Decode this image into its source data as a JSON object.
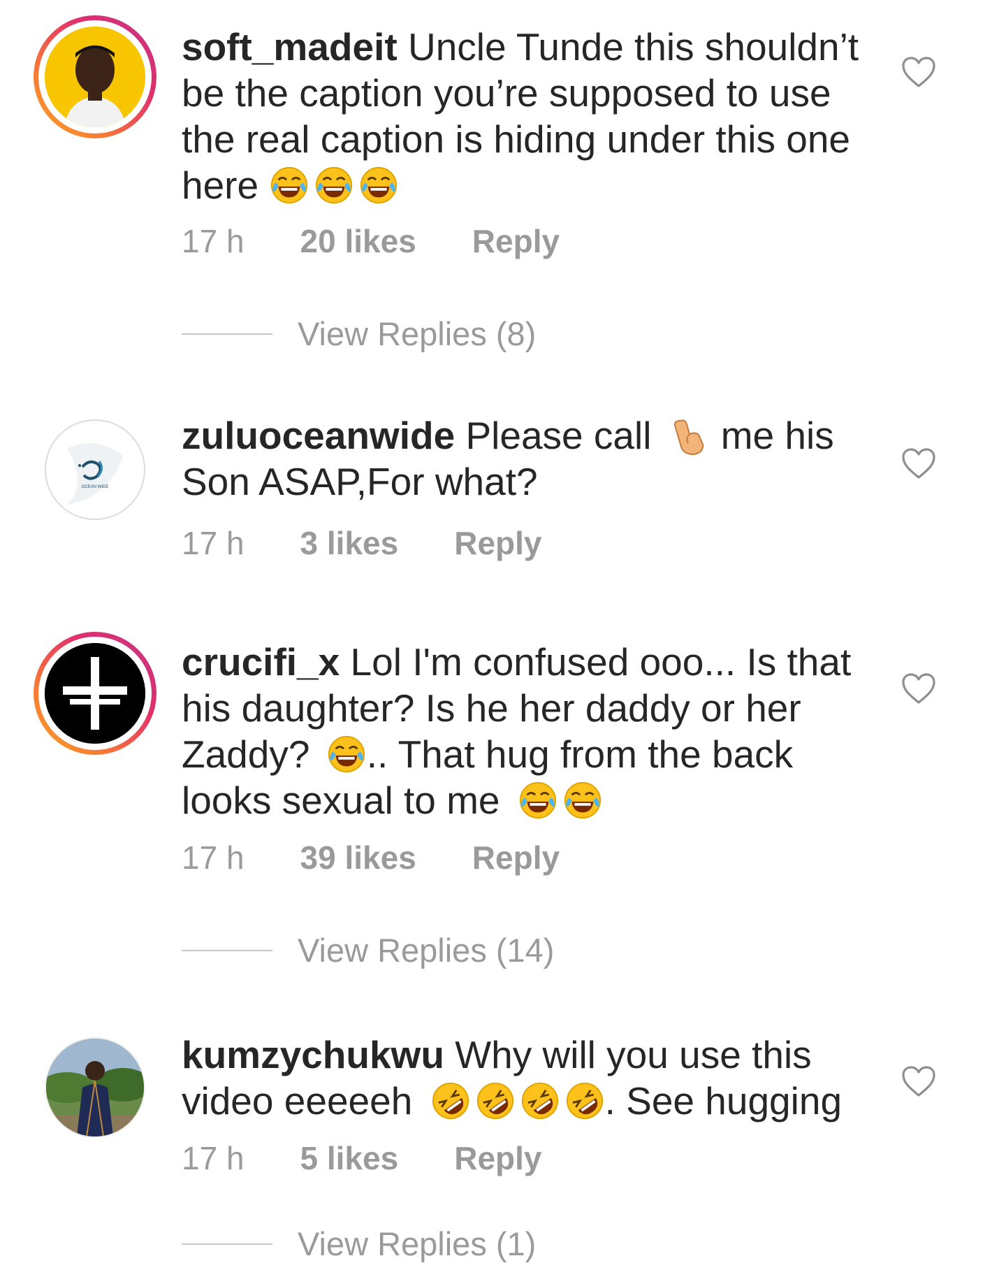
{
  "comments": [
    {
      "username": "soft_madeit",
      "text_lines": [
        "Uncle Tunde this shouldn’t",
        "be the caption you’re supposed to use",
        "the real caption is hiding under this one",
        "here"
      ],
      "time": "17 h",
      "likes": "20 likes",
      "reply": "Reply",
      "view_replies": "View Replies (8)",
      "story_ring": true
    },
    {
      "username": "zuluoceanwide",
      "text_lines": [
        "Please call",
        "me his",
        "Son ASAP,For what?"
      ],
      "avatar_text": "OCEAN WIDE",
      "time": "17 h",
      "likes": "3 likes",
      "reply": "Reply",
      "story_ring": false
    },
    {
      "username": "crucifi_x",
      "text_lines": [
        "Lol I'm confused ooo... Is that",
        "his daughter? Is he her daddy or her",
        "Zaddy?",
        ".. That hug from the back",
        "looks sexual to me"
      ],
      "time": "17 h",
      "likes": "39 likes",
      "reply": "Reply",
      "view_replies": "View Replies (14)",
      "story_ring": true
    },
    {
      "username": "kumzychukwu",
      "text_lines": [
        "Why will you use this",
        "video eeeeeh",
        ". See hugging"
      ],
      "time": "17 h",
      "likes": "5 likes",
      "reply": "Reply",
      "story_ring": false
    }
  ],
  "partial_view_replies": "View Replies (1)",
  "icons": {
    "like": "heart-outline-icon",
    "emoji_laugh": "face-with-tears-of-joy-icon",
    "emoji_rofl": "rolling-on-floor-laughing-icon",
    "emoji_callme": "call-me-hand-icon"
  },
  "colors": {
    "text": "#262626",
    "meta": "#9a9a9a",
    "ring_start": "#f9a825",
    "ring_end": "#c13584"
  }
}
